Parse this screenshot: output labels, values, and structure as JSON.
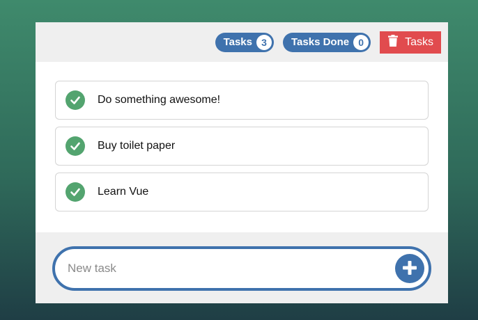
{
  "header": {
    "tasks_label": "Tasks",
    "tasks_count": "3",
    "done_label": "Tasks Done",
    "done_count": "0",
    "delete_label": "Tasks",
    "delete_icon": "trash-icon"
  },
  "tasks": [
    {
      "text": "Do something awesome!",
      "icon": "check-circle-icon"
    },
    {
      "text": "Buy toilet paper",
      "icon": "check-circle-icon"
    },
    {
      "text": "Learn Vue",
      "icon": "check-circle-icon"
    }
  ],
  "new_task": {
    "placeholder": "New task",
    "add_icon": "plus-circle-icon"
  },
  "colors": {
    "accent": "#3f72ad",
    "danger": "#e14b4e",
    "success": "#53a46f"
  }
}
